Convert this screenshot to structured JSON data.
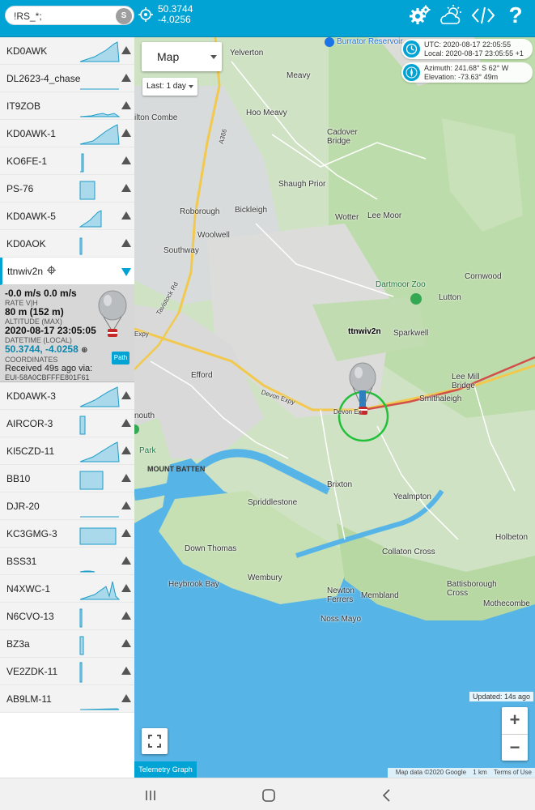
{
  "topbar": {
    "search_value": "!RS_*;",
    "search_button": "S",
    "latitude": "50.3744",
    "longitude": "-4.0256",
    "help_label": "?"
  },
  "sidebar": {
    "items_before": [
      {
        "name": "KD0AWK"
      },
      {
        "name": "DL2623-4_chase"
      },
      {
        "name": "IT9ZOB"
      },
      {
        "name": "KD0AWK-1"
      },
      {
        "name": "KO6FE-1"
      },
      {
        "name": "PS-76"
      },
      {
        "name": "KD0AWK-5"
      },
      {
        "name": "KD0AOK"
      }
    ],
    "selected": {
      "name": "ttnwiv2n",
      "rate": "-0.0 m/s 0.0 m/s",
      "rate_label": "RATE V|H",
      "altitude": "80 m (152 m)",
      "altitude_label": "ALTITUDE (MAX)",
      "datetime": "2020-08-17 23:05:05",
      "datetime_label": "DATETIME (LOCAL)",
      "coordinates": "50.3744, -4.0258",
      "coordinates_label": "COORDINATES",
      "received": "Received 49s ago via:",
      "received_via": "EUI-58A0CBFFFE801F61",
      "path_label": "Path"
    },
    "items_after": [
      {
        "name": "KD0AWK-3"
      },
      {
        "name": "AIRCOR-3"
      },
      {
        "name": "KI5CZD-11"
      },
      {
        "name": "BB10"
      },
      {
        "name": "DJR-20"
      },
      {
        "name": "KC3GMG-3"
      },
      {
        "name": "BSS31"
      },
      {
        "name": "N4XWC-1"
      },
      {
        "name": "N6CVO-13"
      },
      {
        "name": "BZ3a"
      },
      {
        "name": "VE2ZDK-11"
      },
      {
        "name": "AB9LM-11"
      }
    ]
  },
  "map": {
    "type_select": "Map",
    "period_select": "Last: 1 day",
    "utc": "UTC: 2020-08-17 22:05:55",
    "local": "Local: 2020-08-17 23:05:55 +1",
    "azimuth": "Azimuth: 241.68°   S 62° W",
    "elevation": "Elevation: -73.63°     49m",
    "balloon_label": "ttnwiv2n",
    "updated": "Updated: 14s ago",
    "zoom_in": "+",
    "zoom_out": "−",
    "telemetry_button": "Telemetry Graph",
    "attribution_data": "Map data ©2020 Google",
    "attribution_scale": "1 km",
    "attribution_terms": "Terms of Use",
    "places": {
      "burrator": "Burrator Reservoir",
      "yelverton": "Yelverton",
      "meavy": "Meavy",
      "hoo_meavy": "Hoo Meavy",
      "milton_combe": "ilton Combe",
      "cadover_bridge": "Cadover\nBridge",
      "shaugh_prior": "Shaugh Prior",
      "roborough": "Roborough",
      "bickleigh": "Bickleigh",
      "wotter": "Wotter",
      "lee_moor": "Lee Moor",
      "woolwell": "Woolwell",
      "southway": "Southway",
      "dartmoor_zoo": "Dartmoor Zoo",
      "cornwood": "Cornwood",
      "lutton": "Lutton",
      "sparkwell": "Sparkwell",
      "efford": "Efford",
      "devon_expy": "Devon Expy",
      "lee_mill": "Lee Mill\nBridge",
      "smithaleigh": "Smithaleigh",
      "plymouth": "nouth",
      "park": "Park",
      "mount_batten": "MOUNT BATTEN",
      "brixton": "Brixton",
      "yealmpton": "Yealmpton",
      "spriddlestone": "Spriddlestone",
      "down_thomas": "Down Thomas",
      "collaton_cross": "Collaton Cross",
      "holbeton": "Holbeton",
      "wembury": "Wembury",
      "heybrook_bay": "Heybrook Bay",
      "battisborough": "Battisborough\nCross",
      "newton_ferrers": "Newton\nFerrers",
      "membland": "Membland",
      "noss_mayo": "Noss Mayo",
      "mothecombe": "Mothecombe",
      "a386": "A386",
      "tavistock_rd": "Tavistock Rd",
      "expy": "Expy",
      "devon_ex": "Devon Ex"
    }
  },
  "colors": {
    "accent": "#00a3d3",
    "track": "#c9443b",
    "range_circle": "#2bb52b",
    "sea": "#57b4e6"
  }
}
